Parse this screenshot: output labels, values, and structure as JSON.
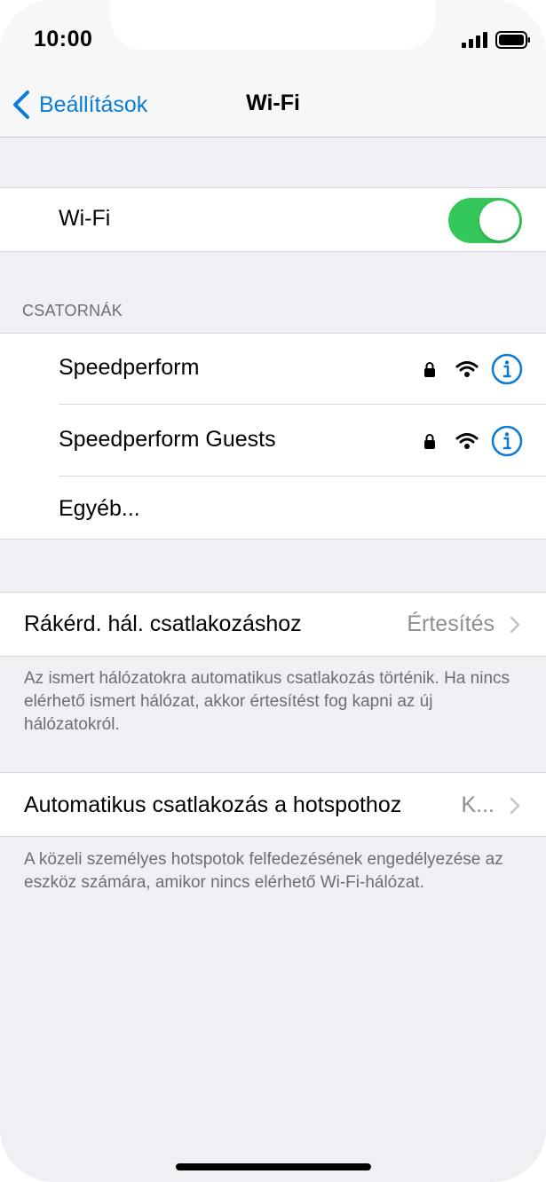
{
  "status_bar": {
    "time": "10:00",
    "signal_icon": "cellular-signal-icon",
    "battery_icon": "battery-full-icon"
  },
  "nav": {
    "back_label": "Beállítások",
    "back_icon": "chevron-left-icon",
    "title": "Wi-Fi"
  },
  "wifi_toggle": {
    "label": "Wi-Fi",
    "state": "on",
    "color": "#34c759"
  },
  "networks": {
    "header": "CSATORNÁK",
    "items": [
      {
        "name": "Speedperform",
        "secured": true
      },
      {
        "name": "Speedperform Guests",
        "secured": true
      }
    ],
    "other_label": "Egyéb..."
  },
  "ask_join": {
    "label": "Rákérd. hál. csatlakozáshoz",
    "value": "Értesítés",
    "footer": "Az ismert hálózatokra automatikus csatlakozás történik. Ha nincs elérhető ismert hálózat, akkor értesítést fog kapni az új hálózatokról."
  },
  "hotspot": {
    "label": "Automatikus csatlakozás a hotspothoz",
    "value": "K...",
    "footer": "A közeli személyes hotspotok felfedezésének engedélyezése az eszköz számára, amikor nincs elérhető Wi-Fi-hálózat."
  },
  "colors": {
    "accent": "#0a7bd8",
    "toggle_on": "#34c759",
    "background": "#efeff4"
  }
}
